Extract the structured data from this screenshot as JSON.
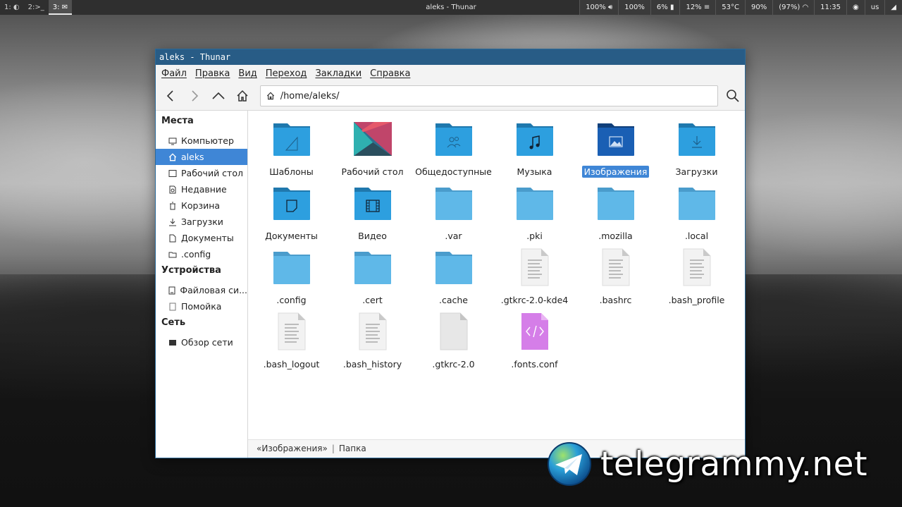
{
  "panel": {
    "workspaces": [
      "1:",
      "2:>_",
      "3:"
    ],
    "active_window_title": "aleks - Thunar",
    "tray": [
      "100%",
      "100%",
      "6%",
      "12%",
      "53°C",
      "90%",
      "(97%)",
      "11:35",
      "",
      "us",
      ""
    ]
  },
  "window": {
    "title": "aleks - Thunar",
    "menu": [
      "Файл",
      "Правка",
      "Вид",
      "Переход",
      "Закладки",
      "Справка"
    ],
    "location": "/home/aleks/",
    "sidebar": {
      "places_heading": "Места",
      "places": [
        "Компьютер",
        "aleks",
        "Рабочий стол",
        "Недавние",
        "Корзина",
        "Загрузки",
        "Документы",
        ".config"
      ],
      "devices_heading": "Устройства",
      "devices": [
        "Файловая си...",
        "Помойка"
      ],
      "network_heading": "Сеть",
      "network": [
        "Обзор сети"
      ]
    },
    "files": [
      {
        "name": "Шаблоны",
        "icon": "templates-folder-icon"
      },
      {
        "name": "Рабочий стол",
        "icon": "desktop-thumbnail-icon"
      },
      {
        "name": "Общедоступные",
        "icon": "public-folder-icon"
      },
      {
        "name": "Музыка",
        "icon": "music-folder-icon"
      },
      {
        "name": "Изображения",
        "icon": "pictures-folder-icon",
        "selected": true
      },
      {
        "name": "Загрузки",
        "icon": "downloads-folder-icon"
      },
      {
        "name": "Документы",
        "icon": "documents-folder-icon"
      },
      {
        "name": "Видео",
        "icon": "videos-folder-icon"
      },
      {
        "name": ".var",
        "icon": "folder-icon"
      },
      {
        "name": ".pki",
        "icon": "folder-icon"
      },
      {
        "name": ".mozilla",
        "icon": "folder-icon"
      },
      {
        "name": ".local",
        "icon": "folder-icon"
      },
      {
        "name": ".config",
        "icon": "folder-icon"
      },
      {
        "name": ".cert",
        "icon": "folder-icon"
      },
      {
        "name": ".cache",
        "icon": "folder-icon"
      },
      {
        "name": ".gtkrc-2.0-kde4",
        "icon": "text-file-icon"
      },
      {
        "name": ".bashrc",
        "icon": "text-file-icon"
      },
      {
        "name": ".bash_profile",
        "icon": "text-file-icon"
      },
      {
        "name": ".bash_logout",
        "icon": "text-file-icon"
      },
      {
        "name": ".bash_history",
        "icon": "text-file-icon"
      },
      {
        "name": ".gtkrc-2.0",
        "icon": "blank-file-icon"
      },
      {
        "name": ".fonts.conf",
        "icon": "xml-file-icon"
      }
    ],
    "status": {
      "selected": "«Изображения»",
      "type": "Папка"
    }
  },
  "watermark": {
    "text": "telegrammy.net"
  },
  "colors": {
    "titlebar": "#285c86",
    "selection": "#3f86d6",
    "folder_light": "#5fb8e8",
    "folder_special": "#2d9fdf",
    "folder_selected": "#1a5fb4"
  }
}
